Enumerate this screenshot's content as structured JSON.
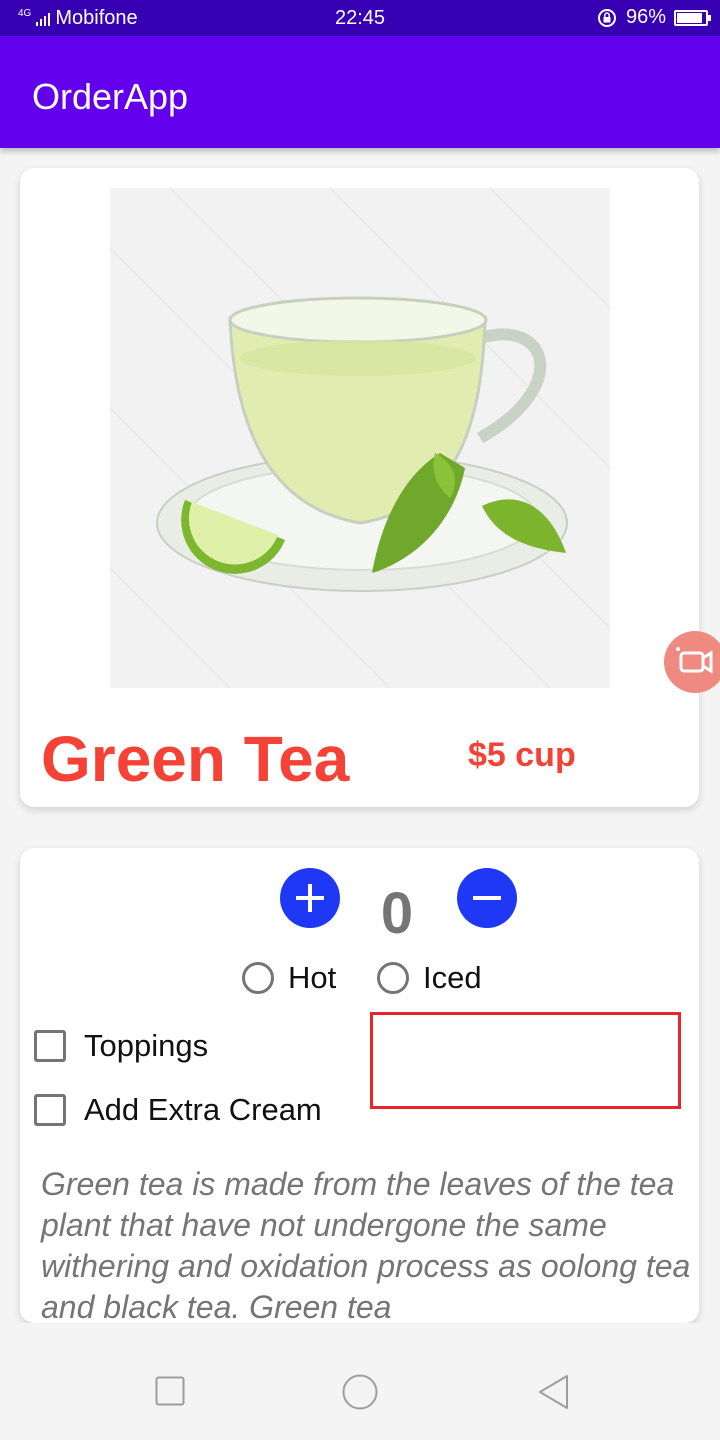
{
  "status_bar": {
    "network": "4G",
    "carrier": "Mobifone",
    "time": "22:45",
    "battery": "96%",
    "battery_level": 0.96
  },
  "app_bar": {
    "title": "OrderApp"
  },
  "product": {
    "name": "Green Tea",
    "price": "$5 cup",
    "image_icon": "green-tea-cup-image",
    "watermark": "pngtree"
  },
  "order": {
    "quantity": "0",
    "increase_icon": "plus-icon",
    "decrease_icon": "minus-icon",
    "temperature_options": [
      {
        "label": "Hot",
        "selected": false
      },
      {
        "label": "Iced",
        "selected": false
      }
    ],
    "extras": [
      {
        "label": "Toppings",
        "checked": false
      },
      {
        "label": "Add Extra Cream",
        "checked": false
      }
    ],
    "notes_value": "",
    "description": "Green tea is made from the leaves of the tea plant that have not undergone the same withering and oxidation process as oolong tea and black tea. Green tea"
  },
  "colors": {
    "status_bar": "#3700b3",
    "app_bar": "#6200ee",
    "accent_red": "#f44336",
    "button_blue": "#1e38f5",
    "highlight_border": "#e8242c"
  },
  "nav_bar": {
    "recents_icon": "square-icon",
    "home_icon": "circle-icon",
    "back_icon": "triangle-back-icon"
  }
}
